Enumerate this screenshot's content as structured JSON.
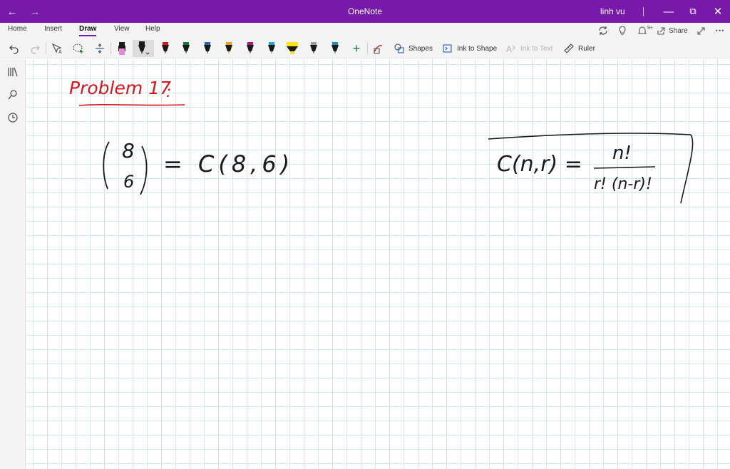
{
  "titlebar": {
    "title": "OneNote",
    "user": "linh vu"
  },
  "menu": {
    "tabs": [
      "Home",
      "Insert",
      "Draw",
      "View",
      "Help"
    ],
    "active": "Draw",
    "share_label": "Share",
    "notification_count": "9+"
  },
  "toolbar": {
    "pens": [
      {
        "name": "pink-highlighter",
        "color": "#e58ad4",
        "type": "highlighter"
      },
      {
        "name": "black-pen",
        "color": "#1a1a1a",
        "type": "pen",
        "selected": true
      },
      {
        "name": "red-pen",
        "color": "#d6161c",
        "type": "pen"
      },
      {
        "name": "green-pen",
        "color": "#0f7a3a",
        "type": "pen"
      },
      {
        "name": "blue-pen",
        "color": "#1f5fbf",
        "type": "pen"
      },
      {
        "name": "orange-pen",
        "color": "#f0a000",
        "type": "pen"
      },
      {
        "name": "magenta-pen",
        "color": "#b0127f",
        "type": "pen"
      },
      {
        "name": "cyan-pen",
        "color": "#1aa4d9",
        "type": "pen"
      },
      {
        "name": "yellow-highlighter",
        "color": "#f5e41b",
        "type": "highlighter"
      },
      {
        "name": "gray-pen",
        "color": "#555555",
        "type": "pen"
      },
      {
        "name": "teal-pen",
        "color": "#1a8ab0",
        "type": "pen"
      }
    ],
    "shapes_label": "Shapes",
    "ink_to_shape_label": "Ink to Shape",
    "ink_to_text_label": "Ink to Text",
    "ruler_label": "Ruler"
  },
  "canvas": {
    "heading": "Problem 17",
    "heading_colon": ":",
    "binom_top": "8",
    "binom_bottom": "6",
    "equals_expr": "= C(8,6)",
    "formula_lhs": "C(n,r) =",
    "formula_numerator": "n!",
    "formula_denominator": "r! (n-r)!",
    "ink_color": "#1a1a1a",
    "heading_color": "#d6161c"
  }
}
